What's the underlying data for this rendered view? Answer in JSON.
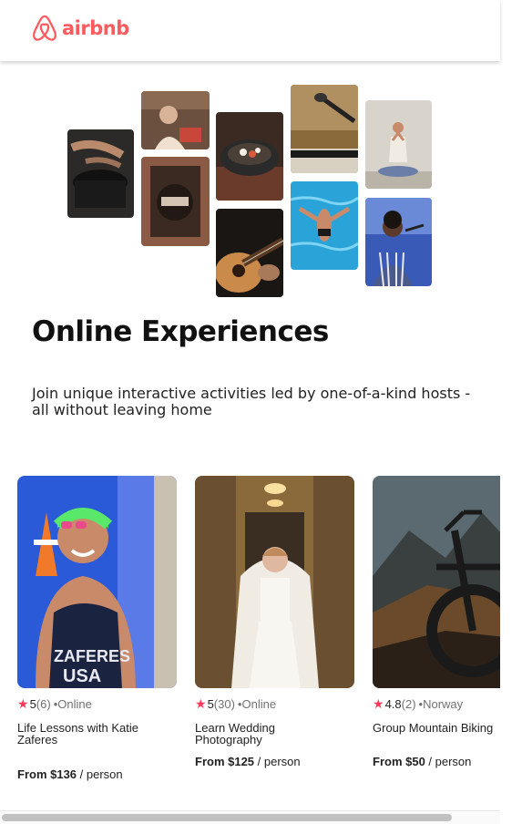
{
  "header": {
    "logo_text": "airbnb"
  },
  "hero": {
    "title": "Online Experiences",
    "subtitle": "Join unique interactive activities led by one-of-a-kind hosts - all without leaving home",
    "collage_icons": [
      "cooking-photo",
      "host-portrait-photo",
      "window-portrait-photo",
      "food-bowl-photo",
      "guitar-photo",
      "microphone-photo",
      "swimming-photo",
      "yoga-photo",
      "singer-photo"
    ]
  },
  "cards": [
    {
      "rating": "5",
      "reviews": "(6)",
      "location": "•Online",
      "title": "Life Lessons with Katie Zaferes",
      "price": "From $136",
      "unit": " / person",
      "image": "triathlete-photo"
    },
    {
      "rating": "5",
      "reviews": "(30)",
      "location": "•Online",
      "title": "Learn Wedding Photography",
      "price": "From $125",
      "unit": " / person",
      "image": "bride-photo"
    },
    {
      "rating": "4.8",
      "reviews": "(2)",
      "location": "•Norway",
      "title": "Group Mountain Biking",
      "price": "From $50",
      "unit": " / person",
      "image": "mountain-bike-photo"
    }
  ],
  "colors": {
    "brand": "#FF5A5F",
    "star": "#FF385C"
  }
}
